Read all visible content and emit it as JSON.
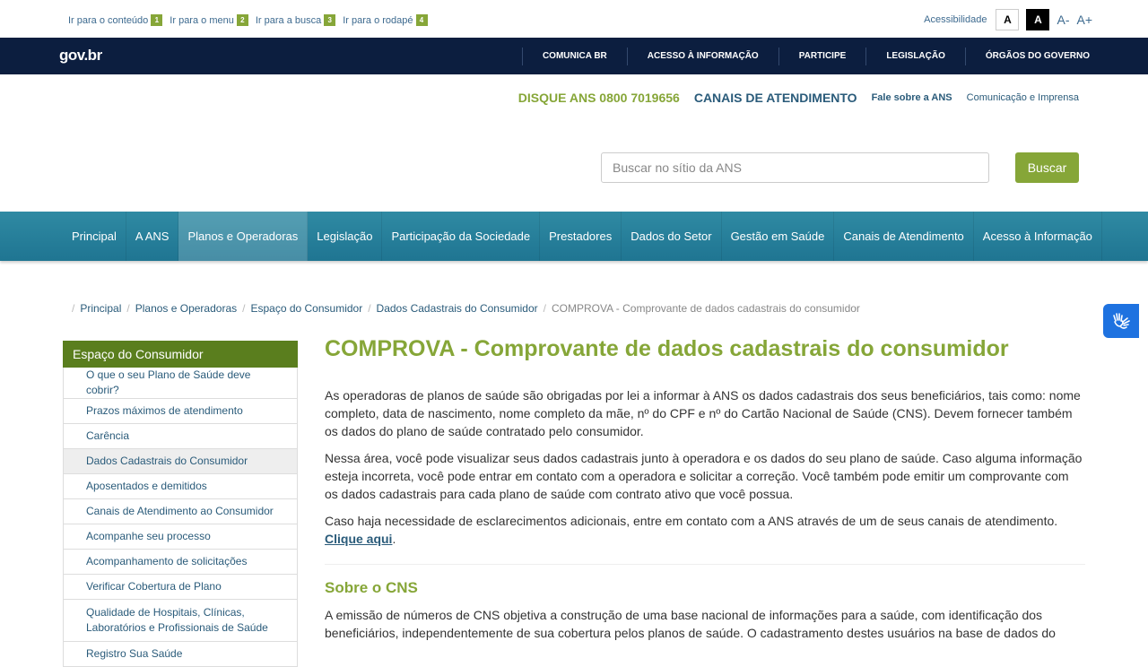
{
  "skip_links": [
    {
      "label": "Ir para o conteúdo",
      "num": "1"
    },
    {
      "label": "Ir para o menu",
      "num": "2"
    },
    {
      "label": "Ir para a busca",
      "num": "3"
    },
    {
      "label": "Ir para o rodapé",
      "num": "4"
    }
  ],
  "accessibility": {
    "label": "Acessibilidade",
    "contrast_light": "A",
    "contrast_dark": "A",
    "font_decrease": "A-",
    "font_increase": "A+"
  },
  "govbar": {
    "logo": "gov.br",
    "items": [
      "COMUNICA BR",
      "ACESSO À INFORMAÇÃO",
      "PARTICIPE",
      "LEGISLAÇÃO",
      "ÓRGÃOS DO GOVERNO"
    ]
  },
  "header": {
    "disque": "DISQUE ANS 0800 7019656",
    "canais": "CANAIS DE ATENDIMENTO",
    "fale": "Fale sobre a ANS",
    "comunicacao": "Comunicação e Imprensa"
  },
  "search": {
    "placeholder": "Buscar no sítio da ANS",
    "button": "Buscar"
  },
  "main_nav": [
    "Principal",
    "A ANS",
    "Planos e Operadoras",
    "Legislação",
    "Participação da Sociedade",
    "Prestadores",
    "Dados do Setor",
    "Gestão em Saúde",
    "Canais de Atendimento",
    "Acesso à Informação"
  ],
  "main_nav_active": "Planos e Operadoras",
  "breadcrumb": [
    "Principal",
    "Planos e Operadoras",
    "Espaço do Consumidor",
    "Dados Cadastrais do Consumidor",
    "COMPROVA - Comprovante de dados cadastrais do consumidor"
  ],
  "sidebar": {
    "title": "Espaço do Consumidor",
    "items": [
      "O que o seu Plano de Saúde deve cobrir?",
      "Prazos máximos de atendimento",
      "Carência",
      "Dados Cadastrais do Consumidor",
      "Aposentados e demitidos",
      "Canais de Atendimento ao Consumidor",
      "Acompanhe seu processo",
      "Acompanhamento de solicitações",
      "Verificar Cobertura de Plano",
      "Qualidade de Hospitais, Clínicas, Laboratórios e Profissionais de Saúde",
      "Registro Sua Saúde"
    ],
    "active": "Dados Cadastrais do Consumidor"
  },
  "content": {
    "title": "COMPROVA - Comprovante de dados cadastrais do consumidor",
    "p1": "As operadoras de planos de saúde são obrigadas por lei a informar à ANS os dados cadastrais dos seus beneficiários, tais como: nome completo, data de nascimento, nome completo da mãe, nº do CPF e nº do Cartão Nacional de Saúde (CNS). Devem fornecer também os dados do plano de saúde contratado pelo consumidor.",
    "p2": "Nessa área, você pode visualizar seus dados cadastrais junto à operadora e os dados do seu plano de saúde. Caso alguma informação esteja incorreta, você pode entrar em contato com a operadora e solicitar a correção. Você também pode emitir um comprovante com os dados cadastrais para cada plano de saúde com contrato ativo que você possua.",
    "p3": "Caso haja necessidade de esclarecimentos adicionais, entre em contato com a ANS através de um de seus canais de atendimento.",
    "p3_link": "Clique aqui",
    "p3_end": ".",
    "subtitle": "Sobre o CNS",
    "p4": "A emissão de números de CNS objetiva a construção de uma base nacional de informações para a saúde, com identificação dos beneficiários, independentemente de sua cobertura pelos planos de saúde. O cadastramento destes usuários na base de dados do"
  },
  "colors": {
    "green": "#86a638",
    "sidebar_green": "#5a7e1e",
    "navy": "#0c1e3f",
    "teal": "#2f8aa3",
    "link": "#2a5b7a",
    "vlibras": "#1e72e0"
  }
}
